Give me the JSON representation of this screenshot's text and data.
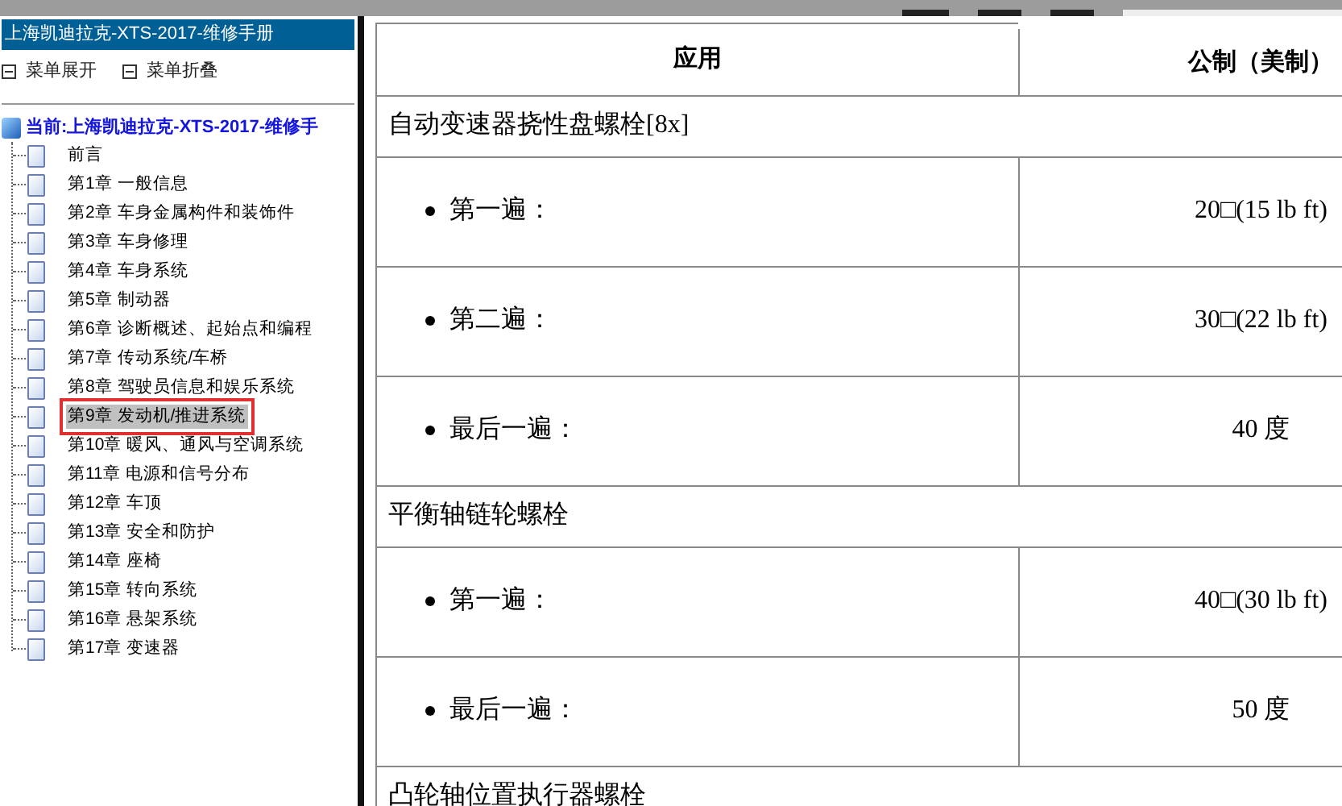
{
  "sidebar": {
    "title": "上海凯迪拉克-XTS-2017-维修手册",
    "menu_buttons": [
      {
        "label": "菜单展开"
      },
      {
        "label": "菜单折叠"
      }
    ],
    "tree": {
      "label": "当前:上海凯迪拉克-XTS-2017-维修手",
      "children": [
        {
          "label": "前言",
          "selected": false
        },
        {
          "label": "第1章 一般信息",
          "selected": false
        },
        {
          "label": "第2章 车身金属构件和装饰件",
          "selected": false
        },
        {
          "label": "第3章 车身修理",
          "selected": false
        },
        {
          "label": "第4章 车身系统",
          "selected": false
        },
        {
          "label": "第5章 制动器",
          "selected": false
        },
        {
          "label": "第6章 诊断概述、起始点和编程",
          "selected": false
        },
        {
          "label": "第7章 传动系统/车桥",
          "selected": false
        },
        {
          "label": "第8章 驾驶员信息和娱乐系统",
          "selected": false
        },
        {
          "label": "第9章 发动机/推进系统",
          "selected": true
        },
        {
          "label": "第10章 暖风、通风与空调系统",
          "selected": false
        },
        {
          "label": "第11章 电源和信号分布",
          "selected": false
        },
        {
          "label": "第12章 车顶",
          "selected": false
        },
        {
          "label": "第13章 安全和防护",
          "selected": false
        },
        {
          "label": "第14章 座椅",
          "selected": false
        },
        {
          "label": "第15章 转向系统",
          "selected": false
        },
        {
          "label": "第16章 悬架系统",
          "selected": false
        },
        {
          "label": "第17章 变速器",
          "selected": false
        }
      ]
    }
  },
  "table": {
    "columns": [
      "应用",
      "公制（美制）"
    ],
    "rows": [
      {
        "kind": "section",
        "label": "自动变速器挠性盘螺栓[8x]"
      },
      {
        "kind": "step",
        "label": "第一遍：",
        "value": "20□(15 lb ft)"
      },
      {
        "kind": "step",
        "label": "第二遍：",
        "value": "30□(22 lb ft)"
      },
      {
        "kind": "step",
        "label": "最后一遍：",
        "value": "40 度"
      },
      {
        "kind": "section",
        "label": "平衡轴链轮螺栓"
      },
      {
        "kind": "step",
        "label": "第一遍：",
        "value": "40□(30 lb ft)"
      },
      {
        "kind": "step",
        "label": "最后一遍：",
        "value": "50 度"
      },
      {
        "kind": "section",
        "label": "凸轮轴位置执行器螺栓"
      }
    ]
  }
}
